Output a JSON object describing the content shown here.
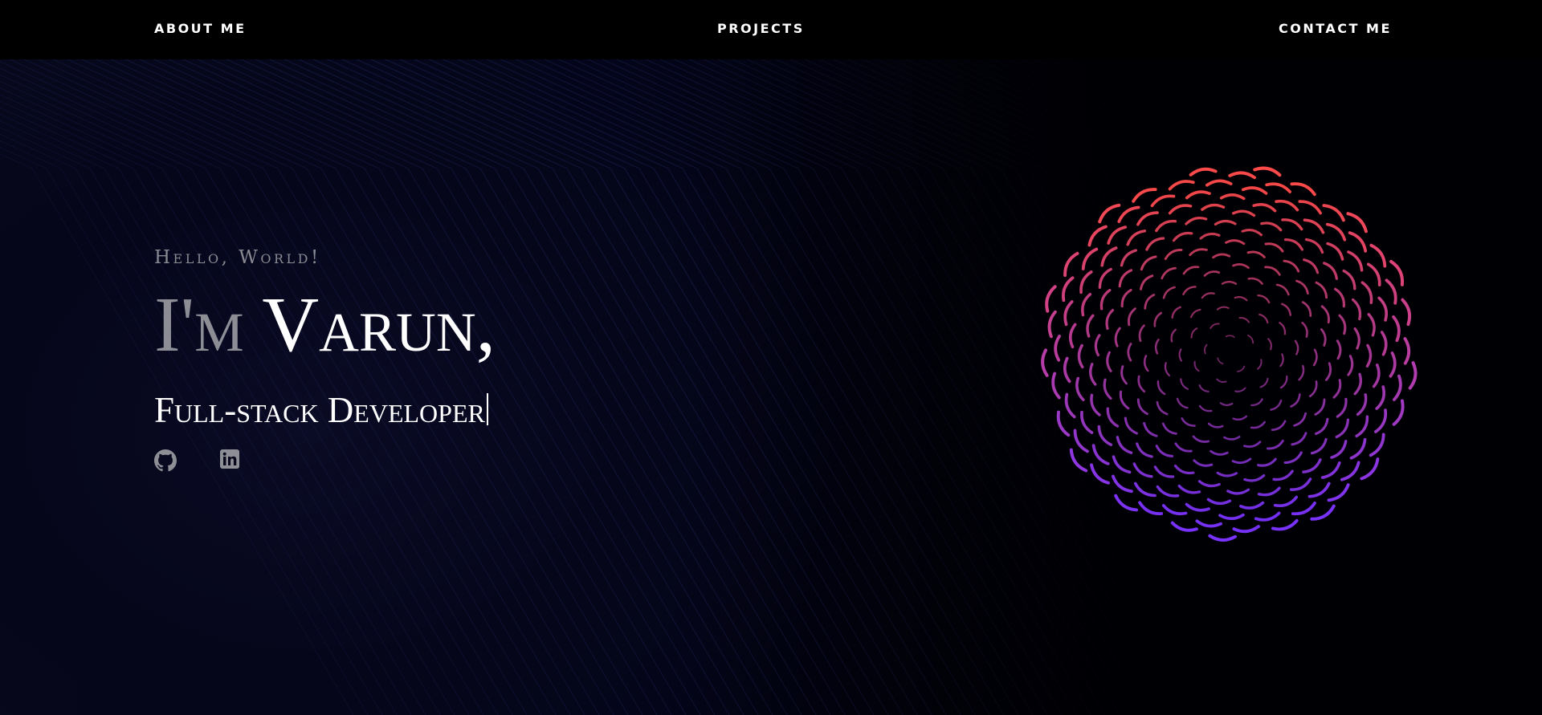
{
  "nav": {
    "about_label": "ABOUT ME",
    "projects_label": "PROJECTS",
    "contact_label": "CONTACT ME"
  },
  "hero": {
    "greeting": "Hello, World!",
    "name_prefix": "I'm ",
    "name": "Varun,",
    "role": "Full-stack Developer"
  },
  "social": {
    "github_icon": "github-icon",
    "linkedin_icon": "linkedin-icon"
  },
  "colors": {
    "nav_background": "#000000",
    "page_background": "#000004",
    "text_primary": "#ffffff",
    "text_muted": "#8a8a93",
    "line_color": "#1f2a5c",
    "sphere_warm": "#ff4a4a",
    "sphere_cool": "#7a33ff"
  }
}
